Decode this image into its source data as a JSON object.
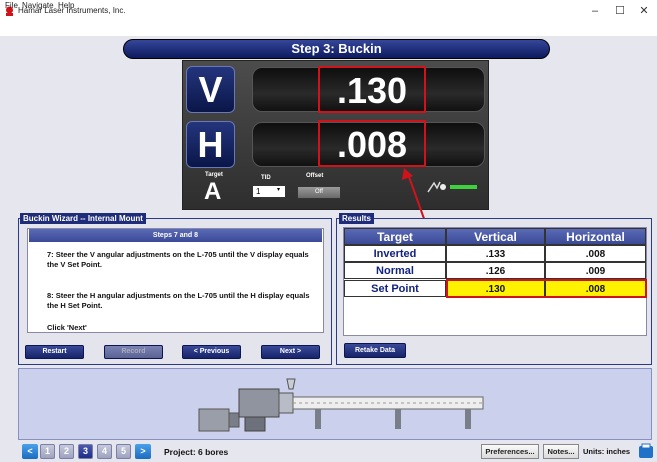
{
  "window": {
    "title": "Hamar Laser Instruments, Inc.",
    "controls": [
      "–",
      "☐",
      "✕"
    ]
  },
  "menu": {
    "file": "File",
    "navigate": "Navigate",
    "help": "Help"
  },
  "step_header": "Step 3: Buckin",
  "display": {
    "v_label": "V",
    "v_value": ".130",
    "h_label": "H",
    "h_value": ".008",
    "target_label": "Target",
    "target_value": "A",
    "tid_label": "TID",
    "tid_value": "1",
    "offset_label": "Offset",
    "offset_button": "Off"
  },
  "wizard": {
    "title": "Buckin Wizard -- Internal Mount",
    "steps_heading": "Steps 7 and 8",
    "step7": "7: Steer the V angular adjustments on the L-705 until the V display equals the V Set Point.",
    "step8": "8: Steer the H angular adjustments on the L-705 until the H display equals the H Set Point.",
    "click_next": "Click 'Next'",
    "buttons": {
      "restart": "Restart",
      "record": "Record",
      "previous": "< Previous",
      "next": "Next >"
    }
  },
  "results": {
    "title": "Results",
    "columns": [
      "Target",
      "Vertical",
      "Horizontal"
    ],
    "rows": [
      {
        "target": "Inverted",
        "vertical": ".133",
        "horizontal": ".008"
      },
      {
        "target": "Normal",
        "vertical": ".126",
        "horizontal": ".009"
      },
      {
        "target": "Set Point",
        "vertical": ".130",
        "horizontal": ".008"
      }
    ],
    "retake": "Retake Data"
  },
  "statusbar": {
    "prev_arrow": "<",
    "steps": [
      "1",
      "2",
      "3",
      "4",
      "5"
    ],
    "active_step": 3,
    "next_arrow": ">",
    "project": "Project: 6 bores",
    "preferences": "Preferences...",
    "notes": "Notes...",
    "units": "Units: inches"
  },
  "colors": {
    "accent": "#1e2c7a",
    "highlight": "#fff200",
    "annotation": "#d0131b"
  }
}
